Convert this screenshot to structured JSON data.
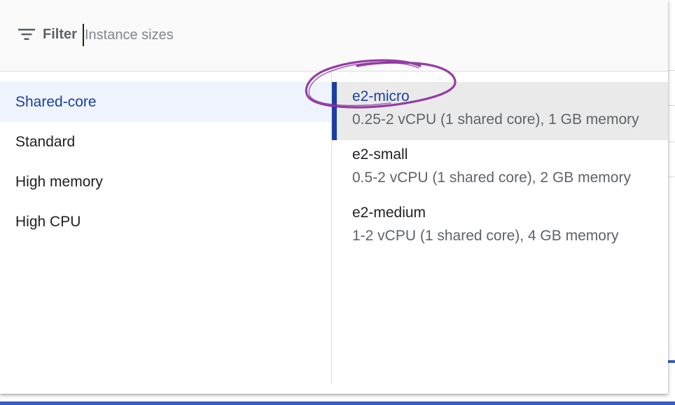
{
  "filter": {
    "label": "Filter",
    "placeholder": "Instance sizes",
    "icon": "filter-icon"
  },
  "categories": [
    {
      "label": "Shared-core",
      "active": true
    },
    {
      "label": "Standard",
      "active": false
    },
    {
      "label": "High memory",
      "active": false
    },
    {
      "label": "High CPU",
      "active": false
    }
  ],
  "machines": [
    {
      "name": "e2-micro",
      "desc": "0.25-2 vCPU (1 shared core), 1 GB memory",
      "selected": true
    },
    {
      "name": "e2-small",
      "desc": "0.5-2 vCPU (1 shared core), 2 GB memory",
      "selected": false
    },
    {
      "name": "e2-medium",
      "desc": "1-2 vCPU (1 shared core), 4 GB memory",
      "selected": false
    }
  ],
  "colors": {
    "accent": "#1a3fa0",
    "selected_bg": "#eaeaea",
    "active_category_bg": "#eef3fd",
    "annotation_circle": "#8a2a9a"
  }
}
